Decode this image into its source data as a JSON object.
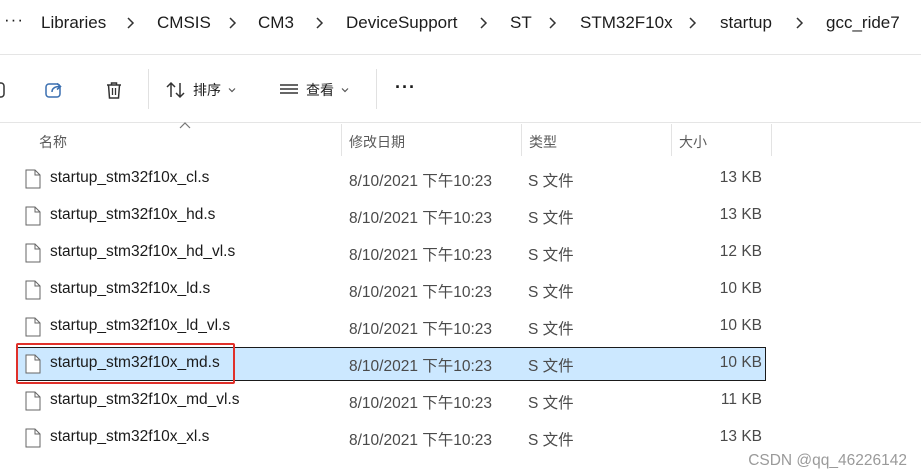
{
  "breadcrumb": {
    "overflow": "···",
    "items": [
      "Libraries",
      "CMSIS",
      "CM3",
      "DeviceSupport",
      "ST",
      "STM32F10x",
      "startup",
      "gcc_ride7"
    ]
  },
  "toolbar": {
    "sort_label": "排序",
    "view_label": "查看",
    "more_label": "···"
  },
  "columns": {
    "name": "名称",
    "date": "修改日期",
    "type": "类型",
    "size": "大小"
  },
  "files": [
    {
      "name": "startup_stm32f10x_cl.s",
      "date": "8/10/2021 下午10:23",
      "type": "S 文件",
      "size": "13 KB"
    },
    {
      "name": "startup_stm32f10x_hd.s",
      "date": "8/10/2021 下午10:23",
      "type": "S 文件",
      "size": "13 KB"
    },
    {
      "name": "startup_stm32f10x_hd_vl.s",
      "date": "8/10/2021 下午10:23",
      "type": "S 文件",
      "size": "12 KB"
    },
    {
      "name": "startup_stm32f10x_ld.s",
      "date": "8/10/2021 下午10:23",
      "type": "S 文件",
      "size": "10 KB"
    },
    {
      "name": "startup_stm32f10x_ld_vl.s",
      "date": "8/10/2021 下午10:23",
      "type": "S 文件",
      "size": "10 KB"
    },
    {
      "name": "startup_stm32f10x_md.s",
      "date": "8/10/2021 下午10:23",
      "type": "S 文件",
      "size": "10 KB",
      "selected": true
    },
    {
      "name": "startup_stm32f10x_md_vl.s",
      "date": "8/10/2021 下午10:23",
      "type": "S 文件",
      "size": "11 KB"
    },
    {
      "name": "startup_stm32f10x_xl.s",
      "date": "8/10/2021 下午10:23",
      "type": "S 文件",
      "size": "13 KB"
    }
  ],
  "watermark": "CSDN @qq_46226142",
  "colors": {
    "selection_bg": "#cce8ff",
    "highlight_border": "#e0302a"
  }
}
